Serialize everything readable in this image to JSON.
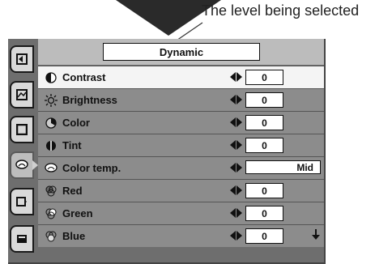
{
  "callout": {
    "text": "The level being selected"
  },
  "menu": {
    "title": "Dynamic",
    "rows": [
      {
        "label": "Contrast",
        "value": "0",
        "icon": "contrast-icon"
      },
      {
        "label": "Brightness",
        "value": "0",
        "icon": "brightness-icon"
      },
      {
        "label": "Color",
        "value": "0",
        "icon": "color-icon"
      },
      {
        "label": "Tint",
        "value": "0",
        "icon": "tint-icon"
      },
      {
        "label": "Color temp.",
        "value": "Mid",
        "icon": "color-temp-icon"
      },
      {
        "label": "Red",
        "value": "0",
        "icon": "red-icon"
      },
      {
        "label": "Green",
        "value": "0",
        "icon": "green-icon"
      },
      {
        "label": "Blue",
        "value": "0",
        "icon": "blue-icon"
      }
    ]
  },
  "side_tabs": [
    "input-icon",
    "pc-adjust-icon",
    "screen-icon",
    "image-adjust-icon",
    "setting-icon",
    "lamp-icon"
  ],
  "colors": {
    "selected_row": "#f4f4f4",
    "row": "#8c8c8c",
    "panel": "#6e6e6e"
  }
}
